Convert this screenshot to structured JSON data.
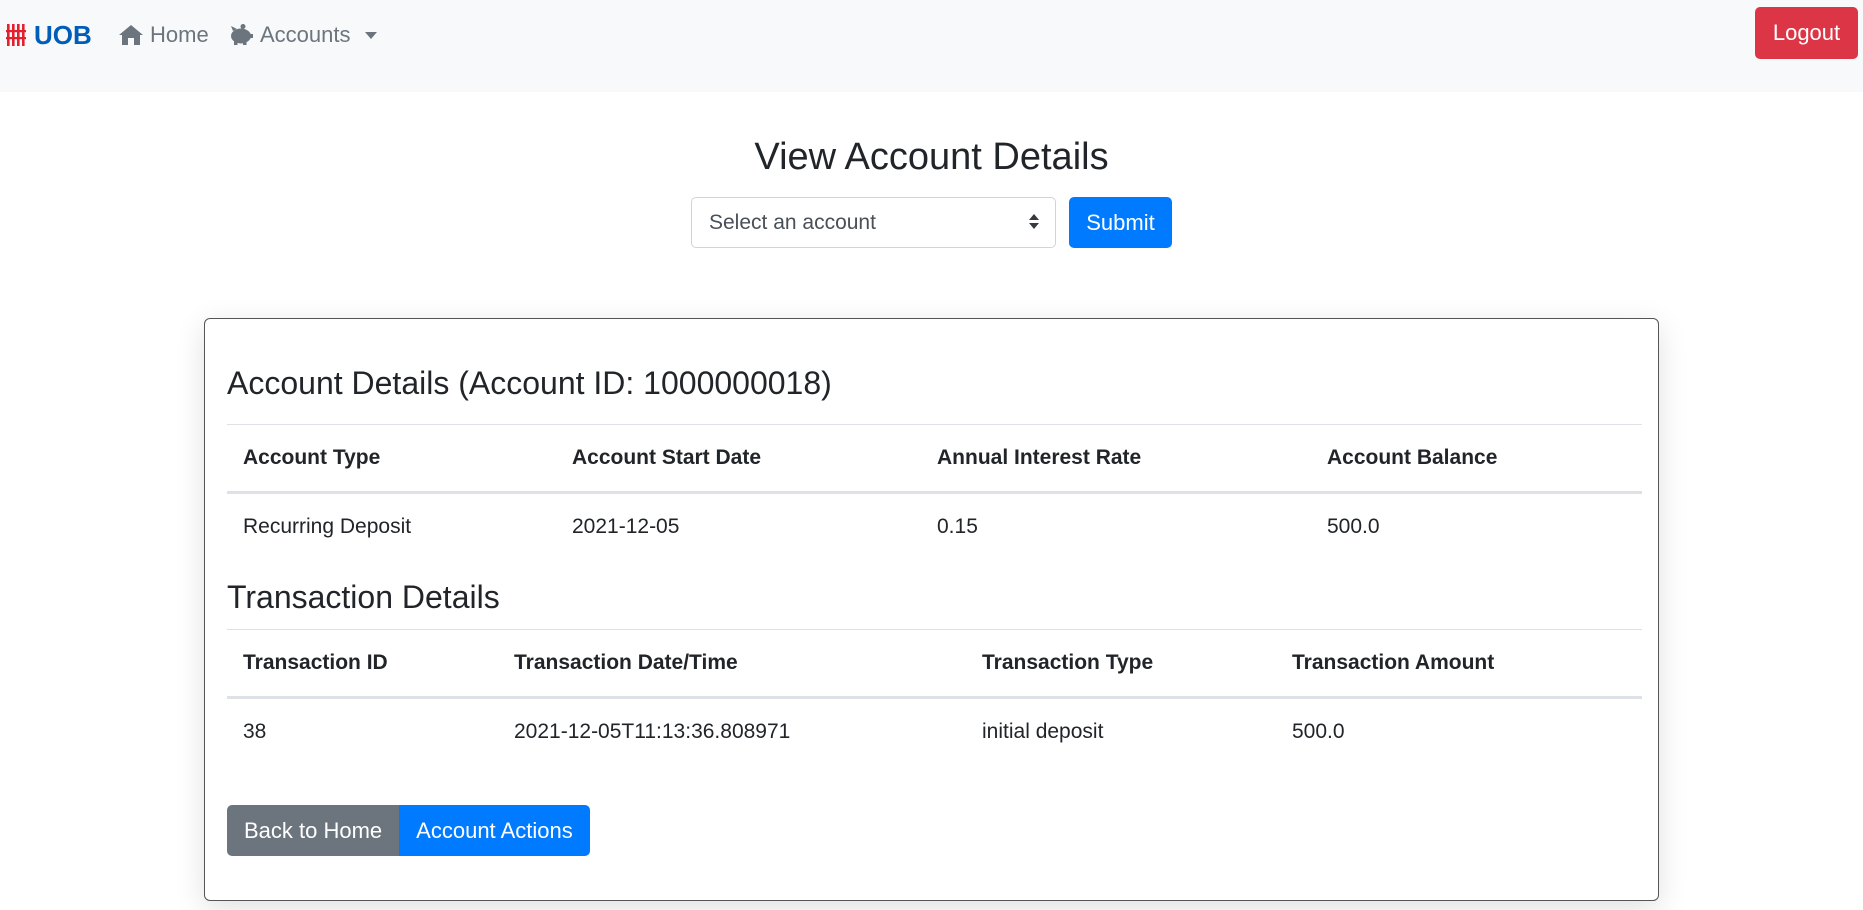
{
  "navbar": {
    "brand": "UOB",
    "home_label": "Home",
    "accounts_label": "Accounts",
    "logout_label": "Logout"
  },
  "page": {
    "title": "View Account Details",
    "select_placeholder": "Select an account",
    "submit_label": "Submit"
  },
  "account": {
    "section_title": "Account Details (Account ID: 1000000018)",
    "headers": [
      "Account Type",
      "Account Start Date",
      "Annual Interest Rate",
      "Account Balance"
    ],
    "row": [
      "Recurring Deposit",
      "2021-12-05",
      "0.15",
      "500.0"
    ]
  },
  "transactions": {
    "section_title": "Transaction Details",
    "headers": [
      "Transaction ID",
      "Transaction Date/Time",
      "Transaction Type",
      "Transaction Amount"
    ],
    "rows": [
      [
        "38",
        "2021-12-05T11:13:36.808971",
        "initial deposit",
        "500.0"
      ]
    ]
  },
  "buttons": {
    "back_label": "Back to Home",
    "actions_label": "Account Actions"
  },
  "colors": {
    "brand": "#005eb8",
    "primary": "#007bff",
    "danger": "#dc3545",
    "secondary": "#6c757d"
  },
  "icons": {
    "brand": "uob-logo-icon",
    "home": "home-icon",
    "accounts": "piggy-bank-icon"
  }
}
